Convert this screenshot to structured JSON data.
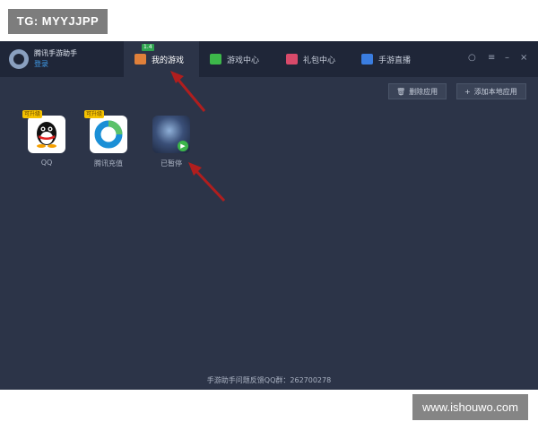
{
  "watermarks": {
    "top_left": "TG: MYYJJPP",
    "bottom_right": "www.ishouwo.com"
  },
  "titlebar": {
    "app_name": "腾讯手游助手",
    "login": "登录"
  },
  "tabs": [
    {
      "label": "我的游戏",
      "badge": "1.4",
      "icon": "user-games-icon",
      "active": true
    },
    {
      "label": "游戏中心",
      "icon": "store-bag-icon",
      "active": false
    },
    {
      "label": "礼包中心",
      "icon": "gift-icon",
      "active": false
    },
    {
      "label": "手游直播",
      "icon": "live-video-icon",
      "active": false
    }
  ],
  "window_controls": [
    "bell-icon",
    "menu-icon",
    "minimize-icon",
    "close-icon"
  ],
  "toolbar": {
    "delete_label": "删除应用",
    "add_label": "添加本地应用"
  },
  "games": [
    {
      "label": "QQ",
      "tag": "可升级",
      "icon": "qq-penguin-icon"
    },
    {
      "label": "腾讯充值",
      "tag": "可升级",
      "icon": "tencent-recharge-icon"
    },
    {
      "label": "已暂停",
      "icon": "game-hero-icon"
    }
  ],
  "footer": "手游助手问题反馈QQ群：262700278",
  "colors": {
    "window_bg": "#2c3448",
    "titlebar_bg": "#1f2638",
    "accent": "#3f9be8",
    "badge": "#2ea44f",
    "arrow": "#b01e1e"
  }
}
